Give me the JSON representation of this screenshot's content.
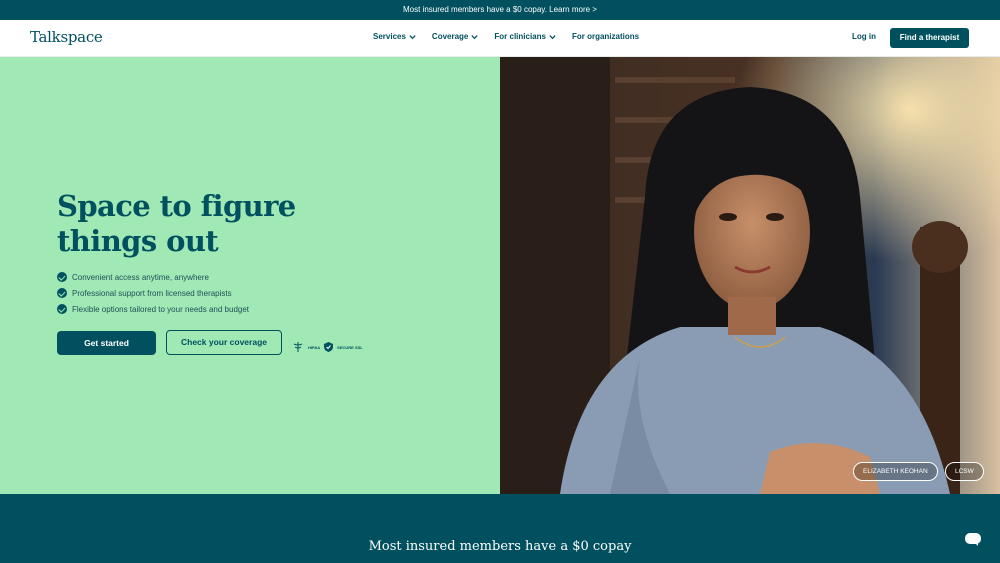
{
  "announcement": {
    "text": "Most insured members have a $0 copay. Learn more >"
  },
  "nav": {
    "logo": "Talkspace",
    "items": [
      {
        "label": "Services",
        "has_dropdown": true
      },
      {
        "label": "Coverage",
        "has_dropdown": true
      },
      {
        "label": "For clinicians",
        "has_dropdown": true
      },
      {
        "label": "For organizations",
        "has_dropdown": false
      }
    ],
    "login": "Log in",
    "cta": "Find a therapist"
  },
  "hero": {
    "headline": "Space to figure things out",
    "bullets": [
      "Convenient access anytime, anywhere",
      "Professional support from licensed therapists",
      "Flexible options tailored to your needs and budget"
    ],
    "primary_button": "Get started",
    "secondary_button": "Check your coverage",
    "badges": [
      "HIPAA",
      "SECURE SSL"
    ]
  },
  "photo": {
    "name_chip": "ELIZABETH KEOHAN",
    "credential_chip": "LCSW"
  },
  "bottom": {
    "title": "Most insured members have a $0 copay"
  },
  "colors": {
    "brand": "#00505f",
    "hero_bg": "#a0e9b5",
    "white": "#ffffff"
  }
}
